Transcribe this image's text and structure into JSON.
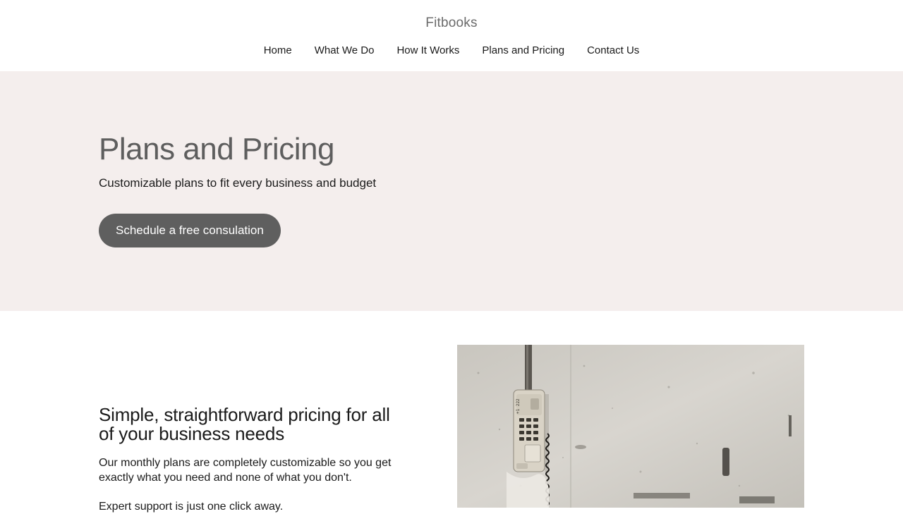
{
  "header": {
    "site_title": "Fitbooks",
    "nav": [
      {
        "label": "Home"
      },
      {
        "label": "What We Do"
      },
      {
        "label": "How It Works"
      },
      {
        "label": "Plans and Pricing"
      },
      {
        "label": "Contact Us"
      }
    ]
  },
  "hero": {
    "title": "Plans and Pricing",
    "subtitle": "Customizable plans to fit every business and budget",
    "button_label": "Schedule a free consulation",
    "background": "#f4eeed",
    "button_color": "#5f5f5f"
  },
  "section": {
    "title": "Simple, straightforward pricing for all of your business needs",
    "body": "Our monthly plans are completely customizable so you get exactly what you need and none of what you don't.",
    "body_2": "Expert support is just one click away.",
    "image_icon": "wall-phone-photo",
    "phone_display": "+1 222"
  }
}
